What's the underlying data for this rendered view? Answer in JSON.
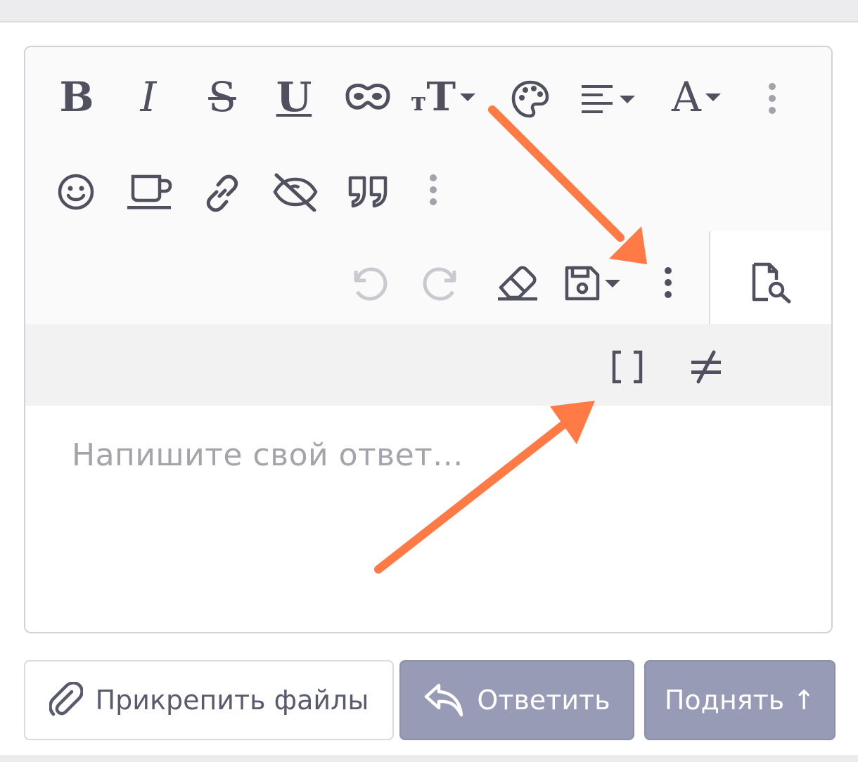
{
  "editor": {
    "placeholder": "Напишите свой ответ...",
    "toolbar_icons": {
      "bold": "B",
      "italic": "I",
      "strike": "S",
      "underline": "U",
      "font_size_small": "т",
      "font_size_big": "T",
      "font_family": "A"
    }
  },
  "actions": {
    "attach_label": "Прикрепить файлы",
    "reply_label": "Ответить",
    "bump_label": "Поднять ↑"
  },
  "colors": {
    "annotation_arrow": "#ff7a45",
    "button_primary": "#979bb6",
    "icon": "#50505f",
    "icon_disabled": "#c9c9cf"
  }
}
